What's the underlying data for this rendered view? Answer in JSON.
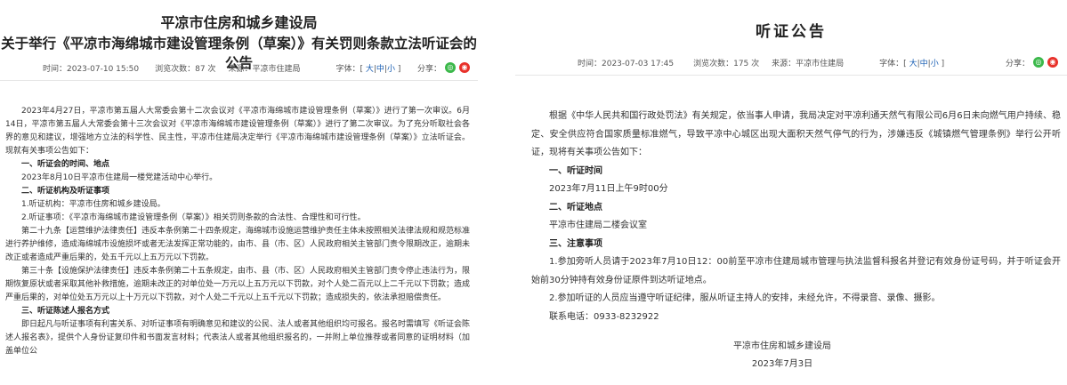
{
  "left": {
    "org": "平凉市住房和城乡建设局",
    "title": "关于举行《平凉市海绵城市建设管理条例（草案）》有关罚则条款立法听证会的公告",
    "meta": {
      "time": "时间：2023-07-10 15:50",
      "views": "浏览次数：87 次",
      "source": "来源：平凉市住建局",
      "font_label": "字体：[",
      "font_large": "大",
      "font_mid": "中",
      "font_small": "小",
      "font_end": "]",
      "share": "分享："
    },
    "intro": "2023年4月27日，平凉市第五届人大常委会第十二次会议对《平凉市海绵城市建设管理条例（草案）》进行了第一次审议。6月14日，平凉市第五届人大常委会第十三次会议对《平凉市海绵城市建设管理条例（草案）》进行了第二次审议。为了充分听取社会各界的意见和建议，增强地方立法的科学性、民主性，平凉市住建局决定举行《平凉市海绵城市建设管理条例（草案）》立法听证会。现就有关事项公告如下：",
    "h1": "一、听证会的时间、地点",
    "p1": "2023年8月10日平凉市住建局一楼党建活动中心举行。",
    "h2": "二、听证机构及听证事项",
    "p2a": "1.听证机构：平凉市住房和城乡建设局。",
    "p2b": "2.听证事项：《平凉市海绵城市建设管理条例（草案）》相关罚则条款的合法性、合理性和可行性。",
    "art29": "第二十九条【运营维护法律责任】违反本条例第二十四条规定，海绵城市设施运营维护责任主体未按照相关法律法规和规范标准进行养护维修，造成海绵城市设施损坏或者无法发挥正常功能的，由市、县（市、区）人民政府相关主管部门责令限期改正，逾期未改正或者造成严重后果的，处五千元以上五万元以下罚款。",
    "art30": "第三十条【设施保护法律责任】违反本条例第二十五条规定，由市、县（市、区）人民政府相关主管部门责令停止违法行为，限期恢复原状或者采取其他补救措施，逾期未改正的对单位处一万元以上五万元以下罚款，对个人处二百元以上二千元以下罚款；造成严重后果的，对单位处五万元以上十万元以下罚款，对个人处二千元以上五千元以下罚款；造成损失的，依法承担赔偿责任。",
    "h3": "三、听证陈述人报名方式",
    "p3": "即日起凡与听证事项有利害关系、对听证事项有明确意见和建议的公民、法人或者其他组织均可报名。报名时需填写《听证会陈述人报名表》，提供个人身份证复印件和书面发言材料；代表法人或者其他组织报名的，一并附上单位推荐或者同意的证明材料（加盖单位公"
  },
  "right": {
    "title": "听证公告",
    "meta": {
      "time": "时间：2023-07-03 17:45",
      "views": "浏览次数：175 次",
      "source": "来源：平凉市住建局",
      "font_label": "字体：[",
      "font_large": "大",
      "font_mid": "中",
      "font_small": "小",
      "font_end": "]",
      "share": "分享："
    },
    "intro": "根据《中华人民共和国行政处罚法》有关规定，依当事人申请，我局决定对平凉利通天然气有限公司6月6日未向燃气用户持续、稳定、安全供应符合国家质量标准燃气，导致平凉中心城区出现大面积天然气停气的行为，涉嫌违反《城镇燃气管理条例》举行公开听证，现将有关事项公告如下：",
    "h1": "一、听证时间",
    "p1": "2023年7月11日上午9时00分",
    "h2": "二、听证地点",
    "p2": "平凉市住建局二楼会议室",
    "h3": "三、注意事项",
    "p3a": "1.参加旁听人员请于2023年7月10日12：00前至平凉市住建局城市管理与执法监督科报名并登记有效身份证号码，并于听证会开始前30分钟持有效身份证原件到达听证地点。",
    "p3b": "2.参加听证的人员应当遵守听证纪律，服从听证主持人的安排，未经允许，不得录音、录像、摄影。",
    "contact": "联系电话：0933-8232922",
    "sign_org": "平凉市住房和城乡建设局",
    "sign_date": "2023年7月3日"
  },
  "icons": {
    "wechat": "wechat-icon",
    "weibo": "weibo-icon"
  },
  "colors": {
    "wechat": "#3bb84a",
    "weibo": "#e8312a",
    "link": "#1a5fb4"
  }
}
